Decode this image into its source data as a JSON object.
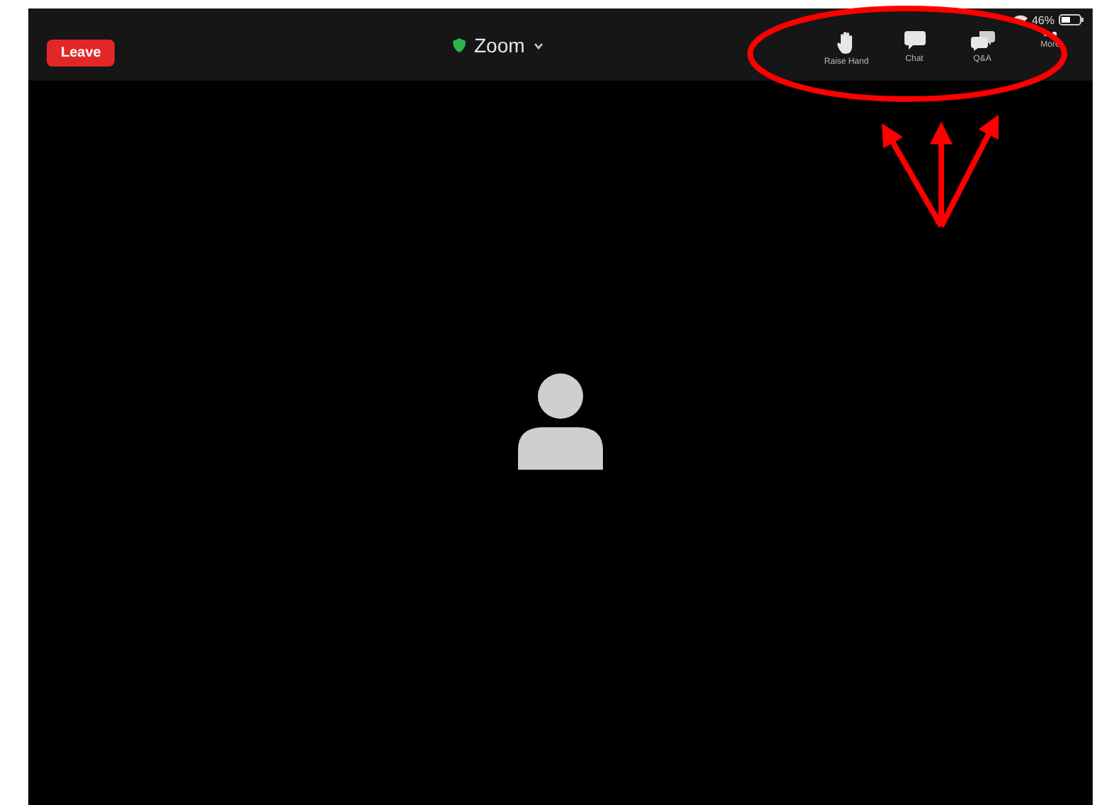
{
  "status_bar": {
    "battery": "46%"
  },
  "top_bar": {
    "leave_button": "Leave",
    "meeting_title": "Zoom",
    "actions": [
      {
        "kind": "hand",
        "label": "Raise Hand"
      },
      {
        "kind": "chat",
        "label": "Chat"
      },
      {
        "kind": "qa",
        "label": "Q&A"
      },
      {
        "kind": "more",
        "label": "More"
      }
    ]
  }
}
